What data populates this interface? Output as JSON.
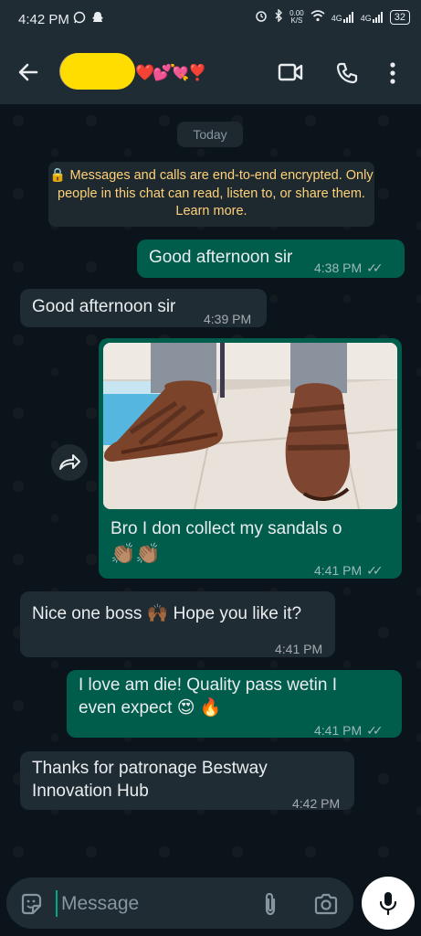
{
  "status_bar": {
    "time": "4:42 PM",
    "net_speed_value": "0.00",
    "net_speed_unit": "K/S",
    "signal1": "4G",
    "signal2": "4G",
    "battery": "32"
  },
  "header": {
    "contact_name_redacted": "",
    "contact_emojis": "❤️💕💘❣️",
    "accent": "#ffdd00"
  },
  "chat": {
    "date_chip": "Today",
    "encryption_notice": "🔒 Messages and calls are end-to-end encrypted. Only people in this chat can read, listen to, or share them. Learn more.",
    "messages": [
      {
        "direction": "outgoing",
        "text": "Good afternoon sir",
        "time": "4:38 PM",
        "status": "read"
      },
      {
        "direction": "incoming",
        "text": "Good afternoon sir",
        "time": "4:39 PM"
      },
      {
        "direction": "outgoing",
        "type": "image",
        "caption": "Bro I don collect my sandals o",
        "emoji": "👏🏽👏🏽",
        "time": "4:41 PM",
        "status": "read"
      },
      {
        "direction": "incoming",
        "text": "Nice one boss",
        "emoji": "🙌🏾",
        "text_after": "Hope you like it?",
        "time": "4:41 PM"
      },
      {
        "direction": "outgoing",
        "text_line1": "I love am die! Quality pass wetin I",
        "text_line2": "even expect",
        "emoji": "😍 🔥",
        "time": "4:41 PM",
        "status": "read"
      },
      {
        "direction": "incoming",
        "text_line1": "Thanks for patronage Bestway",
        "text_line2": "Innovation Hub",
        "time": "4:42 PM"
      }
    ]
  },
  "composer": {
    "placeholder": "Message"
  },
  "icons": {
    "back": "arrow-left-icon",
    "video": "video-camera-icon",
    "call": "phone-icon",
    "more": "more-vertical-icon",
    "forward": "forward-icon",
    "sticker": "sticker-icon",
    "attach": "paperclip-icon",
    "camera": "camera-icon",
    "mic": "microphone-icon"
  },
  "colors": {
    "outgoing_bubble": "#005c4b",
    "incoming_bubble": "#202c33",
    "background": "#0b141a",
    "bar": "#1f2c34",
    "notice_text": "#ffd279"
  }
}
